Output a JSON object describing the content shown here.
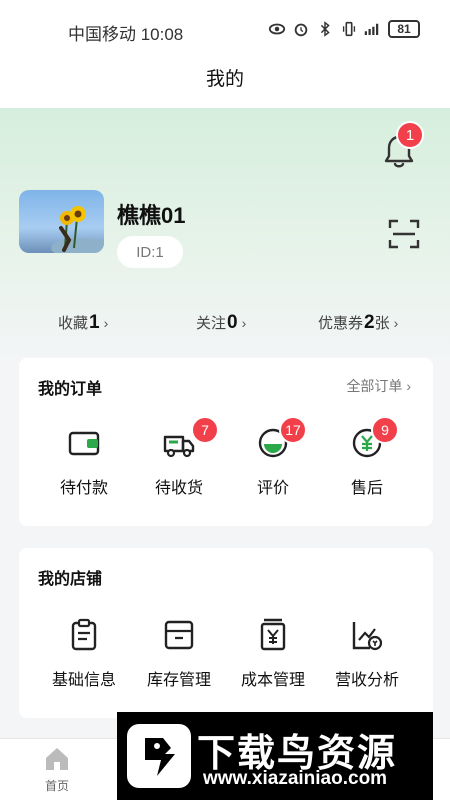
{
  "status": {
    "carrier_time": "中国移动 10:08",
    "battery": "81"
  },
  "nav": {
    "title": "我的"
  },
  "notifications": {
    "count": "1"
  },
  "user": {
    "name": "樵樵01",
    "id": "ID:1"
  },
  "stats": [
    {
      "label": "收藏",
      "value": "1",
      "suffix": ""
    },
    {
      "label": "关注",
      "value": "0",
      "suffix": ""
    },
    {
      "label": "优惠券",
      "value": "2",
      "suffix": "张"
    }
  ],
  "orders": {
    "title": "我的订单",
    "all_label": "全部订单",
    "items": [
      {
        "label": "待付款",
        "badge": ""
      },
      {
        "label": "待收货",
        "badge": "7"
      },
      {
        "label": "评价",
        "badge": "17"
      },
      {
        "label": "售后",
        "badge": "9"
      }
    ]
  },
  "shop": {
    "title": "我的店铺",
    "items": [
      {
        "label": "基础信息"
      },
      {
        "label": "库存管理"
      },
      {
        "label": "成本管理"
      },
      {
        "label": "营收分析"
      }
    ]
  },
  "tabbar": {
    "home_label": "首页"
  },
  "watermark": {
    "title": "下载鸟资源",
    "url": "www.xiazainiao.com"
  },
  "colors": {
    "accent": "#2ba84a",
    "badge": "#f2404a",
    "header_tint": "#d6eedd"
  }
}
